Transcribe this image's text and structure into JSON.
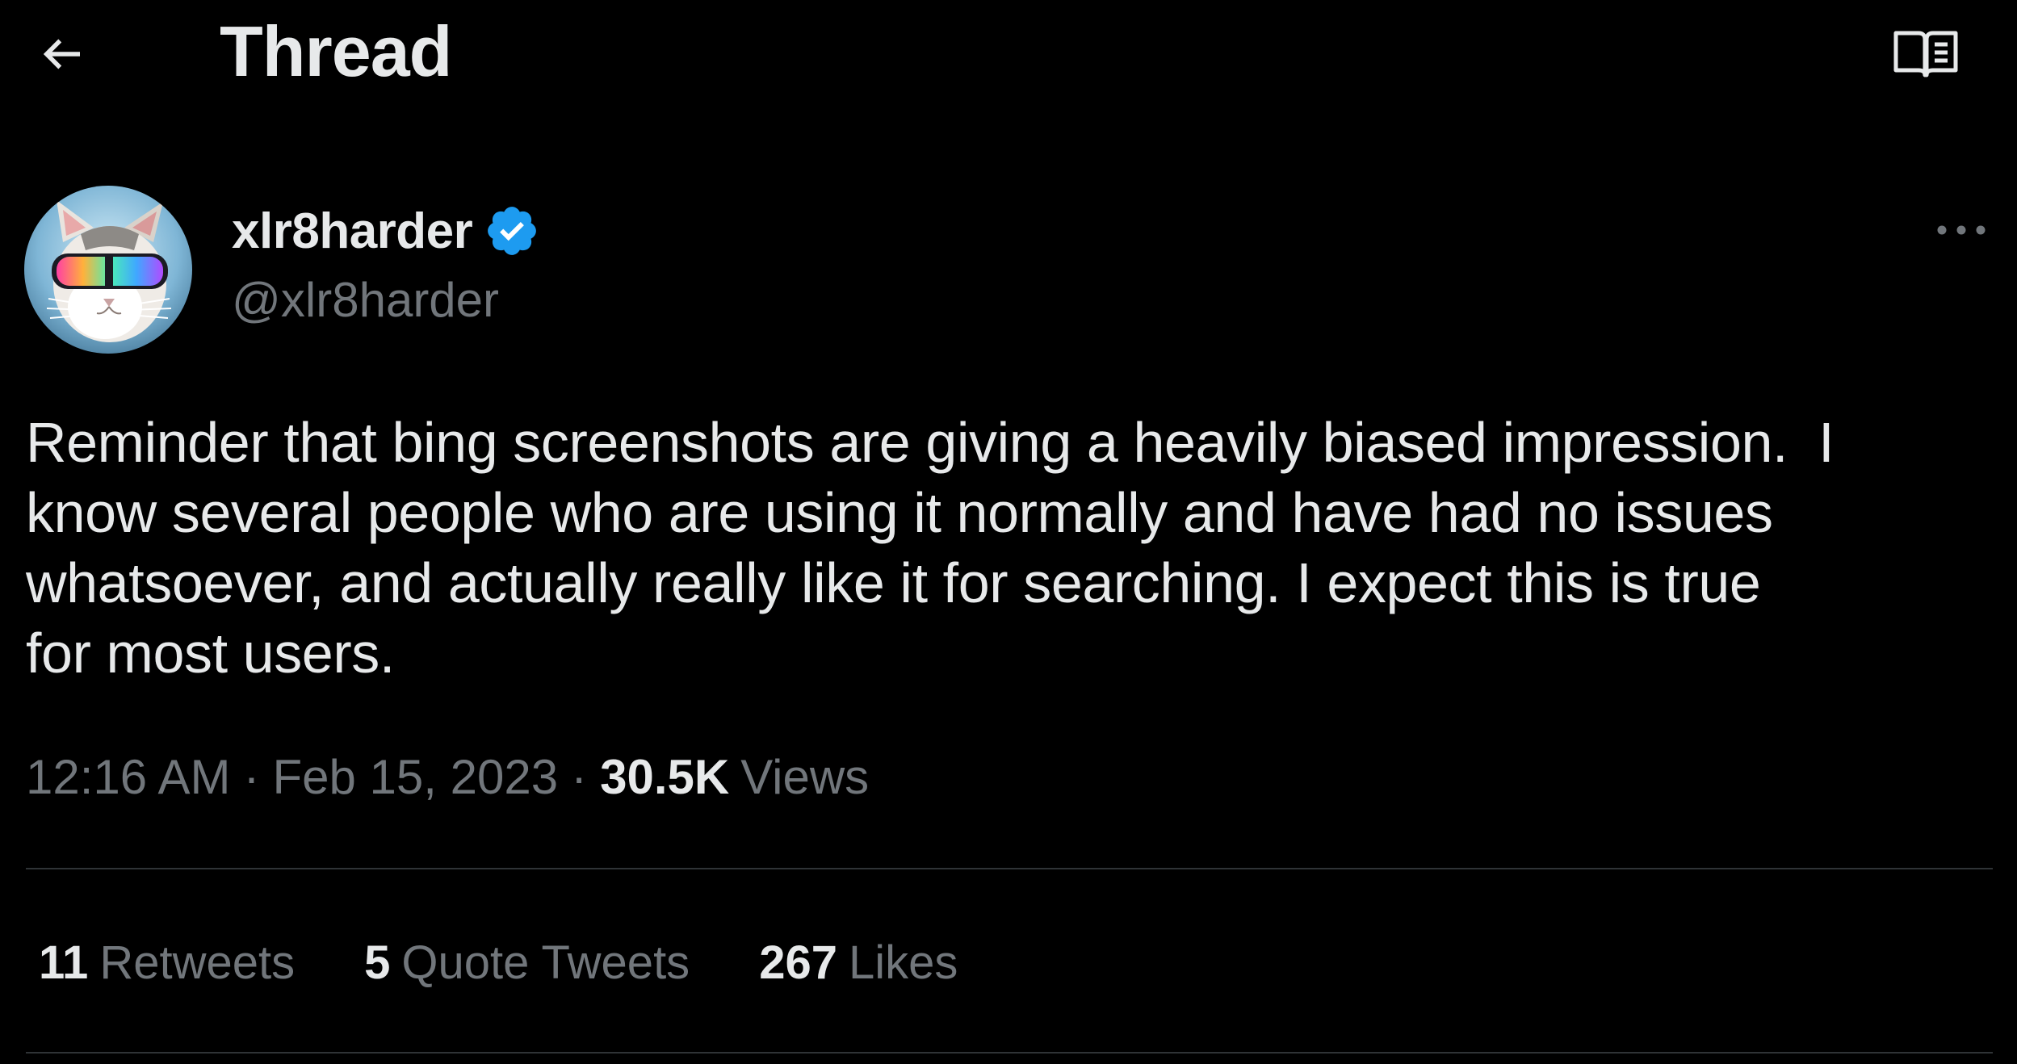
{
  "header": {
    "title": "Thread",
    "back_icon": "arrow-left-icon",
    "reader_icon": "open-book-icon"
  },
  "author": {
    "display_name": "xlr8harder",
    "handle": "@xlr8harder",
    "verified": true,
    "verified_color": "#1d9bf0",
    "avatar_description_icon": "cat-with-rainbow-goggles-avatar"
  },
  "tweet": {
    "text": "Reminder that bing screenshots are giving a heavily biased impression.  I\nknow several people who are using it normally and have had no issues\nwhatsoever, and actually really like it for searching. I expect this is true\nfor most users.",
    "time": "12:16 AM",
    "date": "Feb 15, 2023",
    "separator": "·",
    "views_count": "30.5K",
    "views_label": "Views"
  },
  "stats": {
    "retweets_count": "11",
    "retweets_label": "Retweets",
    "quotes_count": "5",
    "quotes_label": "Quote Tweets",
    "likes_count": "267",
    "likes_label": "Likes"
  },
  "colors": {
    "background": "#000000",
    "primary_text": "#e7e9ea",
    "secondary_text": "#71767b",
    "divider": "#2f3336",
    "accent": "#1d9bf0"
  }
}
